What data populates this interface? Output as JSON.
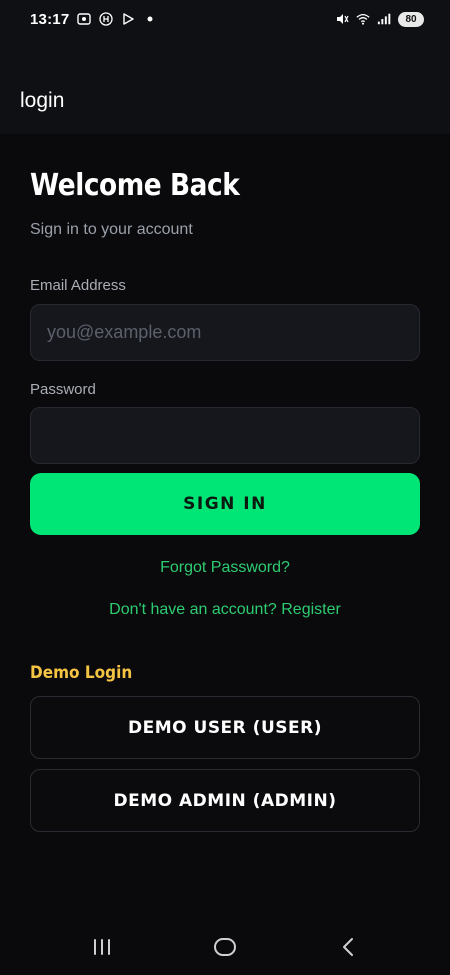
{
  "status_bar": {
    "time": "13:17",
    "left_icons": [
      "screen-record-icon",
      "h-badge-icon",
      "play-store-icon",
      "dot-icon"
    ],
    "right_icons": [
      "mute-icon",
      "wifi-icon",
      "signal-icon"
    ],
    "battery": "80"
  },
  "app_bar": {
    "title": "login"
  },
  "form": {
    "heading": "Welcome Back",
    "subtitle": "Sign in to your account",
    "email_label": "Email Address",
    "email_placeholder": "you@example.com",
    "email_value": "",
    "password_label": "Password",
    "password_value": "",
    "sign_in_label": "SIGN IN",
    "forgot_link": "Forgot Password?",
    "register_link": "Don't have an account? Register"
  },
  "demo": {
    "title": "Demo Login",
    "user_button": "DEMO USER (USER)",
    "admin_button": "DEMO ADMIN (ADMIN)"
  },
  "nav_bar": {
    "items": [
      "recent-apps-icon",
      "home-icon",
      "back-icon"
    ]
  },
  "colors": {
    "background": "#0a0a0c",
    "accent_green": "#00e676",
    "link_green": "#2ecc71",
    "demo_title": "#f5c443",
    "input_bg": "#15171d"
  }
}
